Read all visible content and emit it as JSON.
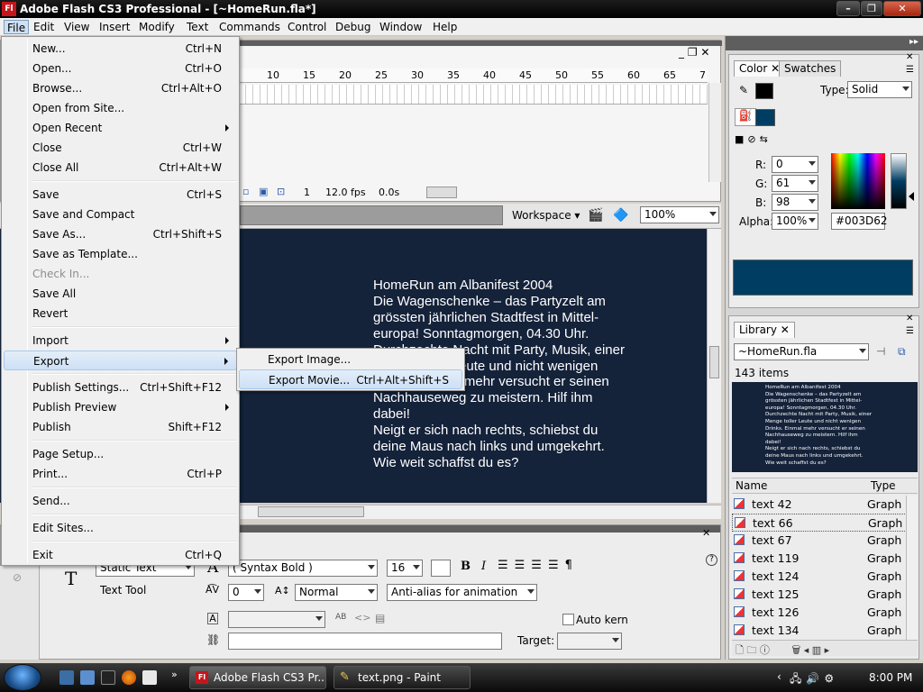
{
  "window": {
    "app_icon": "Fl",
    "title": "Adobe Flash CS3 Professional - [~HomeRun.fla*]"
  },
  "menubar": [
    "File",
    "Edit",
    "View",
    "Insert",
    "Modify",
    "Text",
    "Commands",
    "Control",
    "Debug",
    "Window",
    "Help"
  ],
  "file_menu": [
    {
      "label": "New...",
      "shortcut": "Ctrl+N"
    },
    {
      "label": "Open...",
      "shortcut": "Ctrl+O"
    },
    {
      "label": "Browse...",
      "shortcut": "Ctrl+Alt+O"
    },
    {
      "label": "Open from Site...",
      "shortcut": ""
    },
    {
      "label": "Open Recent",
      "shortcut": ""
    },
    {
      "label": "Close",
      "shortcut": "Ctrl+W"
    },
    {
      "label": "Close All",
      "shortcut": "Ctrl+Alt+W"
    },
    {
      "label": "Save",
      "shortcut": "Ctrl+S"
    },
    {
      "label": "Save and Compact",
      "shortcut": ""
    },
    {
      "label": "Save As...",
      "shortcut": "Ctrl+Shift+S"
    },
    {
      "label": "Save as Template...",
      "shortcut": ""
    },
    {
      "label": "Check In...",
      "shortcut": ""
    },
    {
      "label": "Save All",
      "shortcut": ""
    },
    {
      "label": "Revert",
      "shortcut": ""
    },
    {
      "label": "Import",
      "shortcut": ""
    },
    {
      "label": "Export",
      "shortcut": ""
    },
    {
      "label": "Publish Settings...",
      "shortcut": "Ctrl+Shift+F12"
    },
    {
      "label": "Publish Preview",
      "shortcut": ""
    },
    {
      "label": "Publish",
      "shortcut": "Shift+F12"
    },
    {
      "label": "Page Setup...",
      "shortcut": ""
    },
    {
      "label": "Print...",
      "shortcut": "Ctrl+P"
    },
    {
      "label": "Send...",
      "shortcut": ""
    },
    {
      "label": "Edit Sites...",
      "shortcut": ""
    },
    {
      "label": "Exit",
      "shortcut": "Ctrl+Q"
    }
  ],
  "export_submenu": [
    {
      "label": "Export Image...",
      "shortcut": ""
    },
    {
      "label": "Export Movie...",
      "shortcut": "Ctrl+Alt+Shift+S"
    }
  ],
  "timeline": {
    "ruler_ticks": [
      "10",
      "15",
      "20",
      "25",
      "30",
      "35",
      "40",
      "45",
      "50",
      "55",
      "60",
      "65",
      "7"
    ],
    "frame": "1",
    "fps": "12.0 fps",
    "time": "0.0s"
  },
  "editbar": {
    "workspace": "Workspace",
    "zoom": "100%"
  },
  "stage": {
    "text": "HomeRun am Albanifest 2004\nDie Wagenschenke – das Partyzelt am\ngrössten jährlichen Stadtfest in Mittel-\neuropa! Sonntagmorgen, 04.30 Uhr.\nDurchzechte Nacht mit Party, Musik, einer\nMenge toller Leute und nicht wenigen\nDrinks. Einmal mehr versucht er seinen\nNachhauseweg zu meistern. Hilf ihm\ndabei!\nNeigt er sich nach rechts, schiebst du\ndeine Maus nach links und umgekehrt.\nWie weit schaffst du es?",
    "background": "#14223a"
  },
  "properties": {
    "text_type": "Static Text",
    "tool_label": "Text Tool",
    "font": "( Syntax Bold )",
    "size": "16",
    "letter_spacing": "0",
    "position": "Normal",
    "antialias": "Anti-alias for animation",
    "auto_kern": "Auto kern",
    "target": "Target:"
  },
  "color_panel": {
    "tabs": [
      "Color",
      "Swatches"
    ],
    "type_label": "Type:",
    "type_value": "Solid",
    "r_label": "R:",
    "r": "0",
    "g_label": "G:",
    "g": "61",
    "b_label": "B:",
    "b": "98",
    "alpha_label": "Alpha:",
    "alpha": "100%",
    "hex": "#003D62",
    "swatch_color": "#003d62"
  },
  "library_panel": {
    "tab": "Library",
    "file": "~HomeRun.fla",
    "count": "143 items",
    "col_name": "Name",
    "col_type": "Type",
    "items": [
      {
        "name": "text 42",
        "type": "Graph"
      },
      {
        "name": "text 66",
        "type": "Graph"
      },
      {
        "name": "text 67",
        "type": "Graph"
      },
      {
        "name": "text 119",
        "type": "Graph"
      },
      {
        "name": "text 124",
        "type": "Graph"
      },
      {
        "name": "text 125",
        "type": "Graph"
      },
      {
        "name": "text 126",
        "type": "Graph"
      },
      {
        "name": "text 134",
        "type": "Graph"
      }
    ]
  },
  "taskbar": {
    "tasks": [
      {
        "label": "Adobe Flash CS3 Pr...",
        "icon": "Fl"
      },
      {
        "label": "text.png - Paint",
        "icon": "paint-icon"
      }
    ],
    "clock": "8:00 PM"
  }
}
